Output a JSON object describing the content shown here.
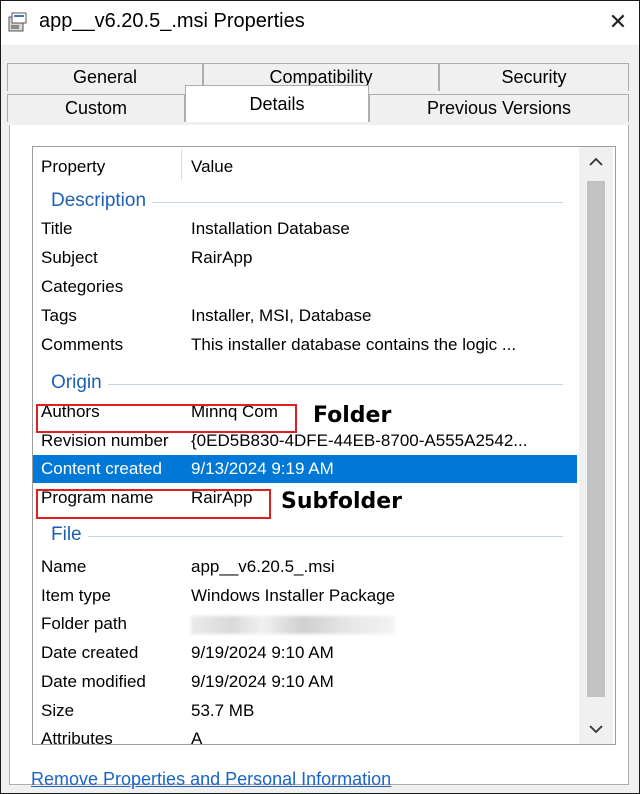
{
  "window": {
    "title": "app__v6.20.5_.msi Properties",
    "icon": "msi-installer-icon",
    "close_icon": "close-icon"
  },
  "tabs": {
    "row1": [
      "General",
      "Compatibility",
      "Security"
    ],
    "row2": [
      "Custom",
      "Details",
      "Previous Versions"
    ],
    "active": "Details"
  },
  "list": {
    "header": {
      "property": "Property",
      "value": "Value"
    },
    "description": {
      "label": "Description",
      "rows": [
        {
          "k": "Title",
          "v": "Installation Database"
        },
        {
          "k": "Subject",
          "v": "RairApp"
        },
        {
          "k": "Categories",
          "v": ""
        },
        {
          "k": "Tags",
          "v": "Installer, MSI, Database"
        },
        {
          "k": "Comments",
          "v": "This installer database contains the logic ..."
        }
      ]
    },
    "origin": {
      "label": "Origin",
      "rows": [
        {
          "k": "Authors",
          "v": "Minnq Com"
        },
        {
          "k": "Revision number",
          "v": "{0ED5B830-4DFE-44EB-8700-A555A2542..."
        },
        {
          "k": "Content created",
          "v": "9/13/2024 9:19 AM"
        },
        {
          "k": "Program name",
          "v": "RairApp"
        }
      ]
    },
    "file": {
      "label": "File",
      "rows": [
        {
          "k": "Name",
          "v": "app__v6.20.5_.msi"
        },
        {
          "k": "Item type",
          "v": "Windows Installer Package"
        },
        {
          "k": "Folder path",
          "v": ""
        },
        {
          "k": "Date created",
          "v": "9/19/2024 9:10 AM"
        },
        {
          "k": "Date modified",
          "v": "9/19/2024 9:10 AM"
        },
        {
          "k": "Size",
          "v": "53.7 MB"
        },
        {
          "k": "Attributes",
          "v": "A"
        }
      ]
    }
  },
  "annotations": {
    "authors_note": "Folder",
    "program_note": "Subfolder"
  },
  "footer": {
    "link": "Remove Properties and Personal Information"
  },
  "colors": {
    "selection": "#0078d7",
    "group_label": "#1e5fb4",
    "highlight_box": "#e02020",
    "link": "#1a64c8"
  }
}
